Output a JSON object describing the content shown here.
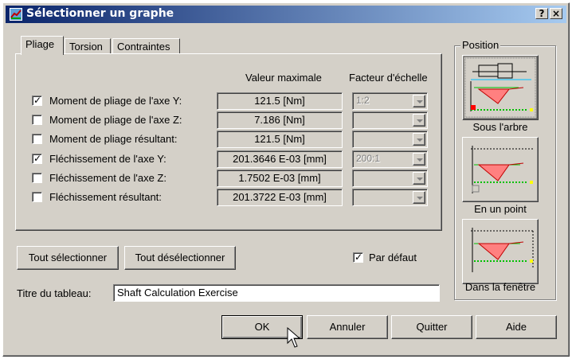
{
  "window": {
    "title": "Sélectionner un graphe",
    "help_btn": "?",
    "close_btn": "×"
  },
  "tabs": [
    {
      "label": "Pliage",
      "active": true
    },
    {
      "label": "Torsion",
      "active": false
    },
    {
      "label": "Contraintes",
      "active": false
    }
  ],
  "table": {
    "col_value": "Valeur maximale",
    "col_scale": "Facteur d'échelle",
    "rows": [
      {
        "label": "Moment de pliage de l'axe Y:",
        "checked": true,
        "value": "121.5 [Nm]",
        "scale": "1:2"
      },
      {
        "label": "Moment de pliage de l'axe Z:",
        "checked": false,
        "value": "7.186 [Nm]",
        "scale": ""
      },
      {
        "label": "Moment de pliage résultant:",
        "checked": false,
        "value": "121.5 [Nm]",
        "scale": ""
      },
      {
        "label": "Fléchissement de l'axe Y:",
        "checked": true,
        "value": "201.3646 E-03 [mm]",
        "scale": "200:1"
      },
      {
        "label": "Fléchissement de l'axe Z:",
        "checked": false,
        "value": "1.7502 E-03 [mm]",
        "scale": ""
      },
      {
        "label": "Fléchissement résultant:",
        "checked": false,
        "value": "201.3722 E-03 [mm]",
        "scale": ""
      }
    ]
  },
  "select_all_label": "Tout sélectionner",
  "deselect_all_label": "Tout désélectionner",
  "default_label": "Par défaut",
  "default_checked": true,
  "checkmark_glyph": "✓",
  "table_title_label": "Titre du tableau:",
  "table_title_value": "Shaft Calculation Exercise",
  "position": {
    "group_label": "Position",
    "options": [
      {
        "label": "Sous l'arbre",
        "icon": "graph-under-shaft-icon"
      },
      {
        "label": "En un point",
        "icon": "graph-at-point-icon"
      },
      {
        "label": "Dans la fenêtre",
        "icon": "graph-in-window-icon"
      }
    ]
  },
  "buttons": {
    "ok": "OK",
    "cancel": "Annuler",
    "quit": "Quitter",
    "help": "Aide"
  }
}
